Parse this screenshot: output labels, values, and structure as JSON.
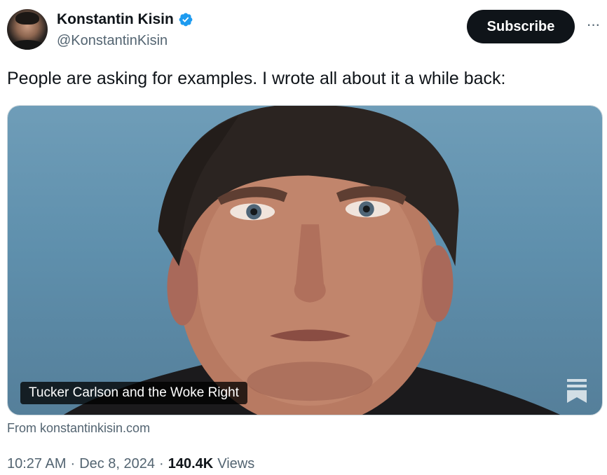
{
  "author": {
    "name": "Konstantin Kisin",
    "handle": "@KonstantinKisin",
    "verified": true,
    "verified_color": "#1d9bf0"
  },
  "actions": {
    "subscribe_label": "Subscribe",
    "more_icon": "more-horizontal-icon"
  },
  "tweet": {
    "text": "People are asking for examples. I wrote all about it a while back:"
  },
  "card": {
    "title": "Tucker Carlson and the Woke Right",
    "source": "From konstantinkisin.com",
    "image_icon": "bookmark-icon"
  },
  "meta": {
    "time": "10:27 AM",
    "separator": "·",
    "date": "Dec 8, 2024",
    "views_count": "140.4K",
    "views_label": "Views"
  },
  "colors": {
    "text_primary": "#0f1419",
    "text_secondary": "#536471",
    "button_bg": "#0f1419",
    "card_sky": "#6f9db8"
  }
}
